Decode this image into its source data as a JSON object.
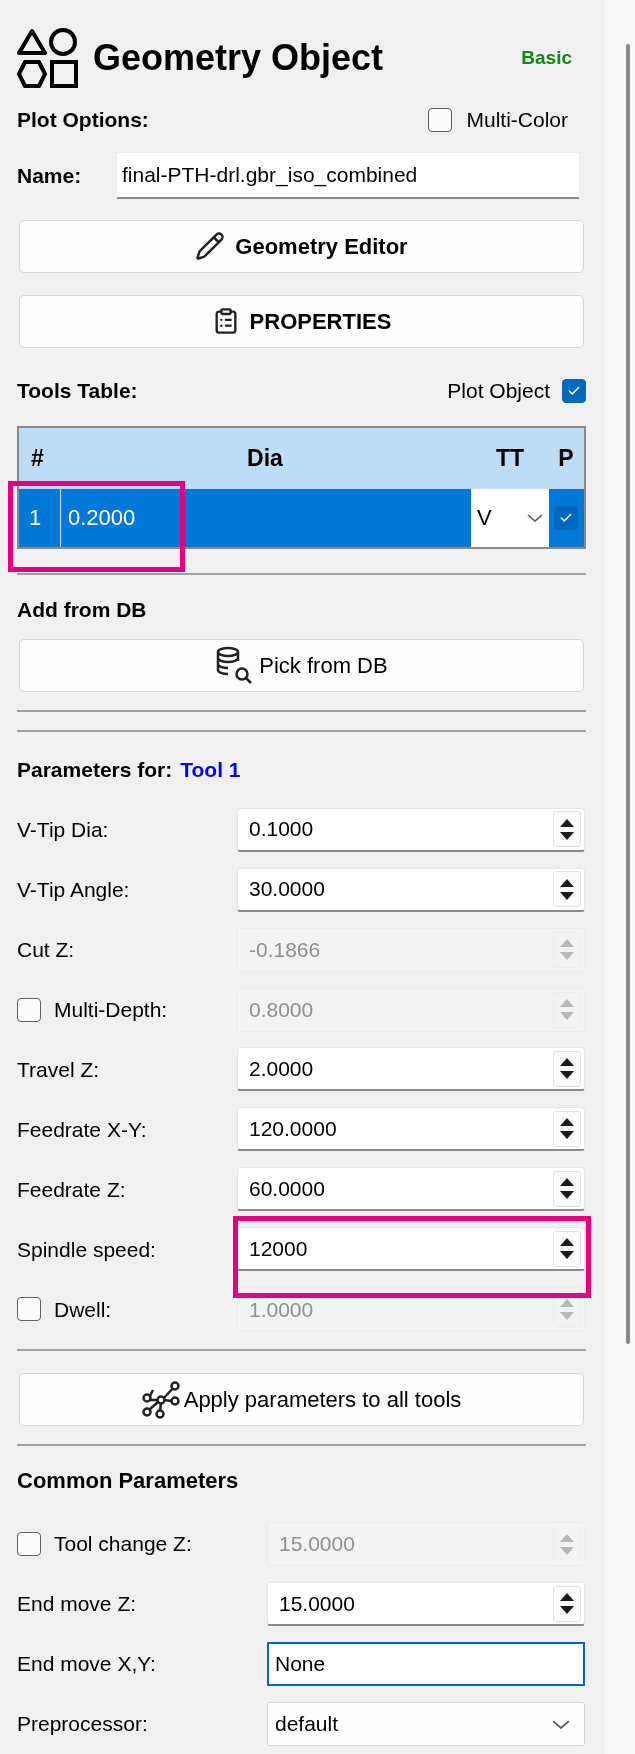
{
  "header": {
    "title": "Geometry Object",
    "level_badge": "Basic"
  },
  "plot_options": {
    "label": "Plot Options:",
    "multi_color": {
      "label": "Multi-Color",
      "checked": false
    }
  },
  "name": {
    "label": "Name:",
    "value": "final-PTH-drl.gbr_iso_combined"
  },
  "top_buttons": [
    {
      "label": "Geometry Editor",
      "kind": "pencil"
    },
    {
      "label": "PROPERTIES",
      "kind": "clipboard"
    }
  ],
  "tools_table": {
    "label": "Tools Table:",
    "plot_object": {
      "label": "Plot Object",
      "checked": true
    },
    "columns": [
      "#",
      "Dia",
      "TT",
      "P"
    ],
    "rows": [
      {
        "number": "1",
        "dia": "0.2000",
        "tt": "V",
        "plot": true,
        "selected": true,
        "highlighted": true
      }
    ]
  },
  "add_from_db": {
    "label": "Add from DB",
    "button": "Pick from DB"
  },
  "parameters": {
    "label": "Parameters for:",
    "tool": "Tool 1",
    "rows": [
      {
        "kind": "spin",
        "label": "V-Tip Dia:",
        "value": "0.1000",
        "disabled": false
      },
      {
        "kind": "spin",
        "label": "V-Tip Angle:",
        "value": "30.0000",
        "disabled": false
      },
      {
        "kind": "spin",
        "label": "Cut Z:",
        "value": "-0.1866",
        "disabled": true
      },
      {
        "kind": "spin",
        "label": "Multi-Depth:",
        "value": "0.8000",
        "disabled": true,
        "checked": false
      },
      {
        "kind": "spin",
        "label": "Travel Z:",
        "value": "2.0000",
        "disabled": false
      },
      {
        "kind": "spin",
        "label": "Feedrate X-Y:",
        "value": "120.0000",
        "disabled": false
      },
      {
        "kind": "spin",
        "label": "Feedrate Z:",
        "value": "60.0000",
        "disabled": false
      },
      {
        "kind": "spin",
        "label": "Spindle speed:",
        "value": "12000",
        "disabled": false,
        "highlighted": true
      },
      {
        "kind": "spin",
        "label": "Dwell:",
        "value": "1.0000",
        "disabled": true,
        "checked": false
      }
    ]
  },
  "apply_button": "Apply parameters to all tools",
  "common": {
    "label": "Common Parameters",
    "rows": [
      {
        "kind": "spin",
        "label": "Tool change Z:",
        "value": "15.0000",
        "disabled": true,
        "checked": false
      },
      {
        "kind": "spin",
        "label": "End move Z:",
        "value": "15.0000",
        "disabled": false
      },
      {
        "kind": "text",
        "label": "End move X,Y:",
        "value": "None"
      },
      {
        "kind": "select",
        "label": "Preprocessor:",
        "value": "default"
      }
    ]
  }
}
